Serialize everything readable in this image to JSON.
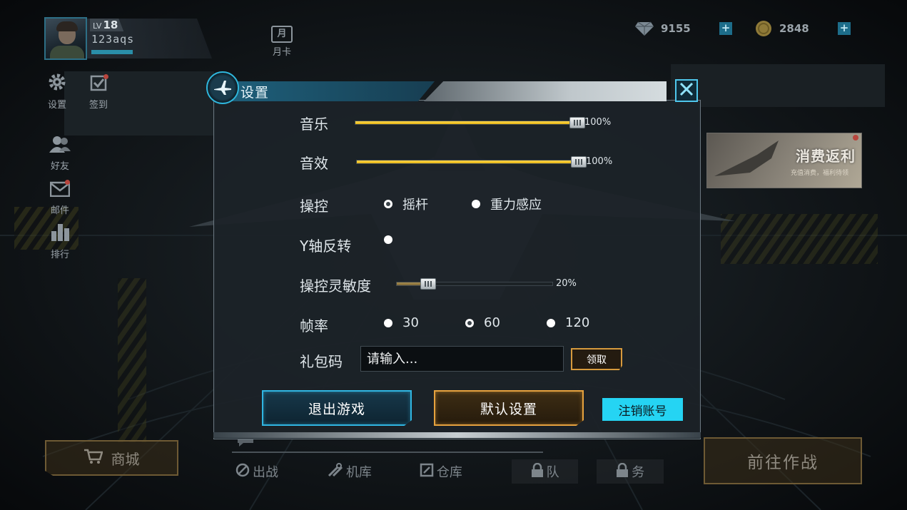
{
  "player": {
    "level_prefix": "LV",
    "level": "18",
    "username": "123aqs",
    "exp_fraction": 0.36
  },
  "topbar": {
    "monthly_card_label": "月卡",
    "monthly_card_glyph": "月",
    "gems": "9155",
    "gold": "2848",
    "plus_label": "+"
  },
  "sidebar": {
    "items": [
      {
        "label": "设置",
        "icon": "gear-icon"
      },
      {
        "label": "签到",
        "icon": "checkin-icon"
      },
      {
        "label": "好友",
        "icon": "friends-icon"
      },
      {
        "label": "邮件",
        "icon": "mail-icon"
      },
      {
        "label": "排行",
        "icon": "ranking-icon"
      }
    ]
  },
  "event_banner": {
    "title": "消费返利",
    "subtitle": "充值消费，福利待领"
  },
  "bottom": {
    "shop_label": "商城",
    "battle_label": "前往作战",
    "nav": [
      {
        "label": "出战",
        "icon": "sortie-icon"
      },
      {
        "label": "机库",
        "icon": "tools-icon"
      },
      {
        "label": "仓库",
        "icon": "storage-icon"
      },
      {
        "label": "队",
        "icon": "lock-icon"
      },
      {
        "label": "务",
        "icon": "lock-icon"
      }
    ]
  },
  "settings": {
    "title": "设置",
    "music": {
      "label": "音乐",
      "value": 100,
      "value_text": "100%"
    },
    "sfx": {
      "label": "音效",
      "value": 100,
      "value_text": "100%"
    },
    "control": {
      "label": "操控",
      "options": [
        "摇杆",
        "重力感应"
      ],
      "selected": "摇杆"
    },
    "invert_y": {
      "label": "Y轴反转",
      "checked": false
    },
    "sensitivity": {
      "label": "操控灵敏度",
      "value": 20,
      "value_text": "20%"
    },
    "framerate": {
      "label": "帧率",
      "options": [
        "30",
        "60",
        "120"
      ],
      "selected": "60"
    },
    "gift_code": {
      "label": "礼包码",
      "placeholder": "请输入...",
      "value": "",
      "claim_label": "领取"
    },
    "buttons": {
      "quit": "退出游戏",
      "default": "默认设置",
      "logout": "注销账号"
    }
  },
  "colors": {
    "accent_blue": "#30b6e2",
    "accent_orange": "#e6a23e",
    "slider_yellow": "#f2c12e",
    "logout_cyan": "#25d4f3"
  }
}
